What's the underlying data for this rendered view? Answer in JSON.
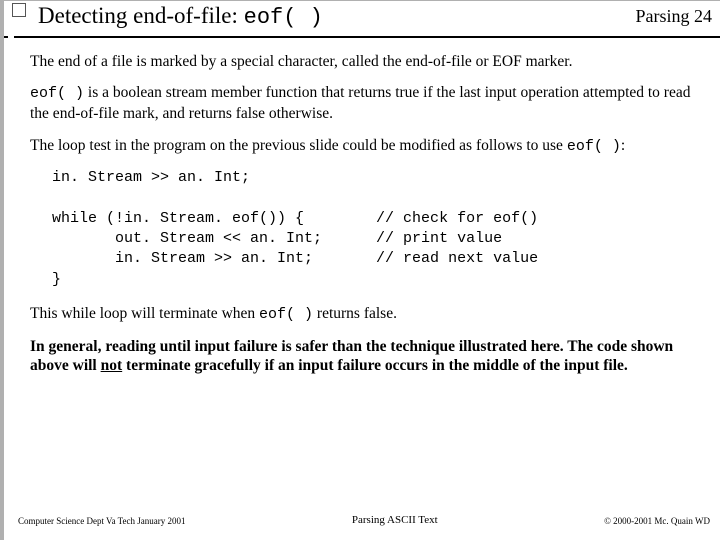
{
  "header": {
    "title_pre": "Detecting end-of-file:  ",
    "title_code": "eof( )",
    "topic": "Parsing",
    "page": "24"
  },
  "body": {
    "p1": "The end of a file is marked by a special character, called the end-of-file or EOF marker.",
    "p2_code": "eof( )",
    "p2_rest": " is a boolean stream member function that returns true if the last input operation attempted to read the end-of-file mark, and returns false otherwise.",
    "p3_a": "The loop test in the program on the previous slide could be modified as follows to use ",
    "p3_code": "eof( )",
    "p3_b": ":",
    "code": "in. Stream >> an. Int;\n\nwhile (!in. Stream. eof()) {        // check for eof()\n       out. Stream << an. Int;      // print value\n       in. Stream >> an. Int;       // read next value\n}",
    "p4_a": "This while loop will terminate when ",
    "p4_code": "eof( )",
    "p4_b": " returns false.",
    "p5_a": "In general, reading until input failure is safer than the technique illustrated here. The code shown above will ",
    "p5_u": "not",
    "p5_b": " terminate gracefully if an input failure occurs in the middle of the input file."
  },
  "footer": {
    "left": "Computer Science Dept Va Tech January 2001",
    "center": "Parsing ASCII Text",
    "right": "© 2000-2001 Mc. Quain WD"
  }
}
